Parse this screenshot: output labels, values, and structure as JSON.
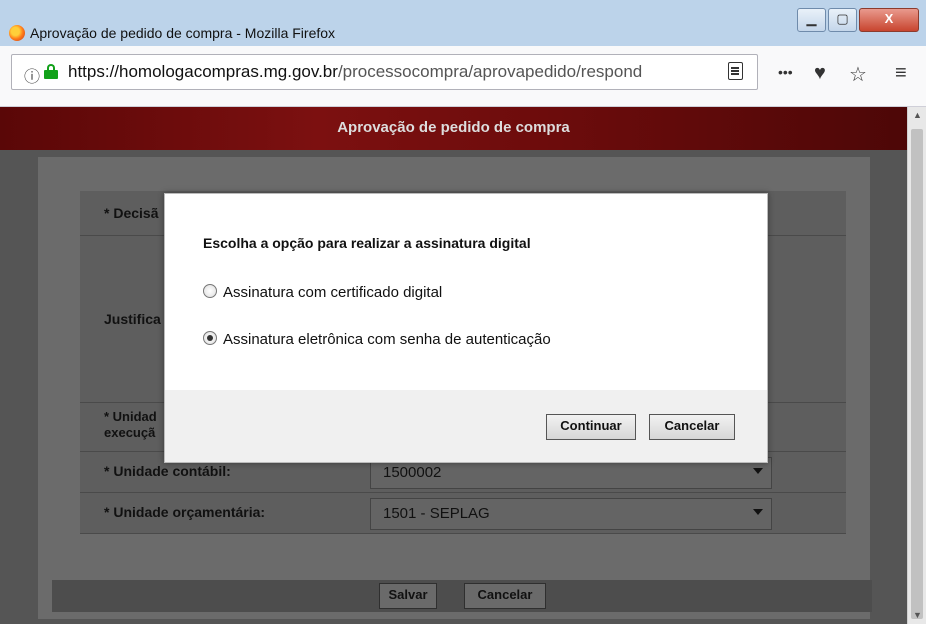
{
  "window": {
    "title": "Aprovação de pedido de compra - Mozilla Firefox",
    "min_glyph": "▁",
    "max_glyph": "▢",
    "close_glyph": "X"
  },
  "browser": {
    "info_glyph": "ⓘ",
    "url_host": "https://homologacompras.mg.gov.br",
    "url_path": "/processocompra/aprovapedido/respond",
    "more_glyph": "•••",
    "pocket_glyph": "♥",
    "star_glyph": "☆",
    "menu_glyph": "≡"
  },
  "page": {
    "banner_title": "Aprovação de pedido de compra",
    "form": {
      "decisao_label": "* Decisã",
      "justificativa_label": "Justifica",
      "unidade_execucao_label_1": "* Unidad",
      "unidade_execucao_label_2": "execuçã",
      "unidade_contabil_label": "* Unidade contábil:",
      "unidade_contabil_value": "1500002",
      "unidade_orcamentaria_label": "* Unidade orçamentária:",
      "unidade_orcamentaria_value": "1501 - SEPLAG"
    },
    "buttons": {
      "salvar": "Salvar",
      "cancelar": "Cancelar"
    }
  },
  "modal": {
    "heading": "Escolha a opção para realizar a assinatura digital",
    "options": [
      {
        "label": "Assinatura com certificado digital",
        "selected": false
      },
      {
        "label": "Assinatura eletrônica com senha de autenticação",
        "selected": true
      }
    ],
    "continue_label": "Continuar",
    "cancel_label": "Cancelar"
  },
  "scrollbar": {
    "up_glyph": "▲",
    "down_glyph": "▼"
  },
  "colors": {
    "banner": "#7c1010",
    "overlay": "#555555",
    "lock": "#12a11a"
  }
}
